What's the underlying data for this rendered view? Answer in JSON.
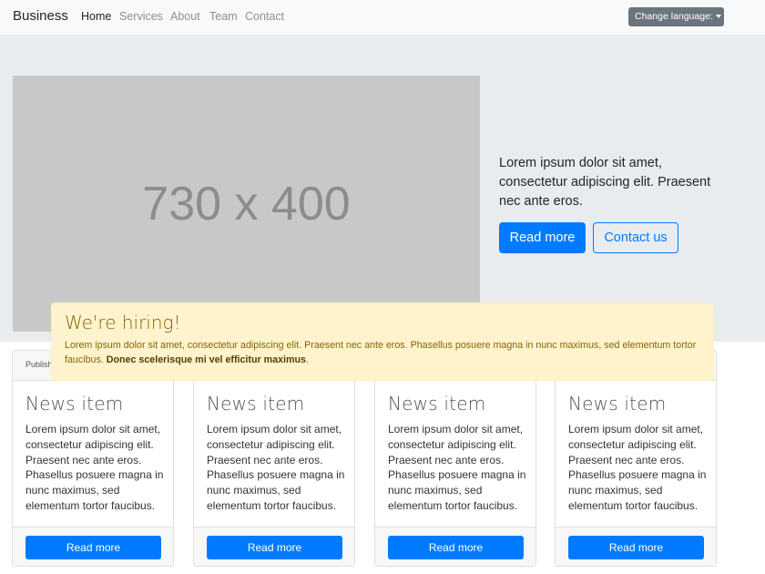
{
  "navbar": {
    "brand": "Business",
    "links": [
      "Home",
      "Services",
      "About",
      "Team",
      "Contact"
    ],
    "language_button": "Change language:"
  },
  "hero": {
    "placeholder_text": "730 x 400",
    "text": "Lorem ipsum dolor sit amet, consectetur adipiscing elit. Praesent nec ante eros.",
    "read_more": "Read more",
    "contact_us": "Contact us"
  },
  "alert": {
    "title": "We're hiring!",
    "body": "Lorem ipsum dolor sit amet, consectetur adipiscing elit. Praesent nec ante eros. Phasellus posuere magna in nunc maximus, sed elementum tortor faucibus.",
    "bold": "Donec scelerisque mi vel efficitur maximus",
    "end": "."
  },
  "cards": [
    {
      "header": "Publish",
      "title": "News item",
      "text": "Lorem ipsum dolor sit amet, consectetur adipiscing elit. Praesent nec ante eros. Phasellus posuere magna in nunc maximus, sed elementum tortor faucibus.",
      "button": "Read more"
    },
    {
      "header": "",
      "title": "News item",
      "text": "Lorem ipsum dolor sit amet, consectetur adipiscing elit. Praesent nec ante eros. Phasellus posuere magna in nunc maximus, sed elementum tortor faucibus.",
      "button": "Read more"
    },
    {
      "header": "",
      "title": "News item",
      "text": "Lorem ipsum dolor sit amet, consectetur adipiscing elit. Praesent nec ante eros. Phasellus posuere magna in nunc maximus, sed elementum tortor faucibus.",
      "button": "Read more"
    },
    {
      "header": "",
      "title": "News item",
      "text": "Lorem ipsum dolor sit amet, consectetur adipiscing elit. Praesent nec ante eros. Phasellus posuere magna in nunc maximus, sed elementum tortor faucibus.",
      "button": "Read more"
    }
  ],
  "colors": {
    "primary": "#007bff",
    "secondary": "#6c757d",
    "warning_bg": "#fff3cd",
    "warning_text": "#856404",
    "hero_bg": "#e9ecef"
  }
}
